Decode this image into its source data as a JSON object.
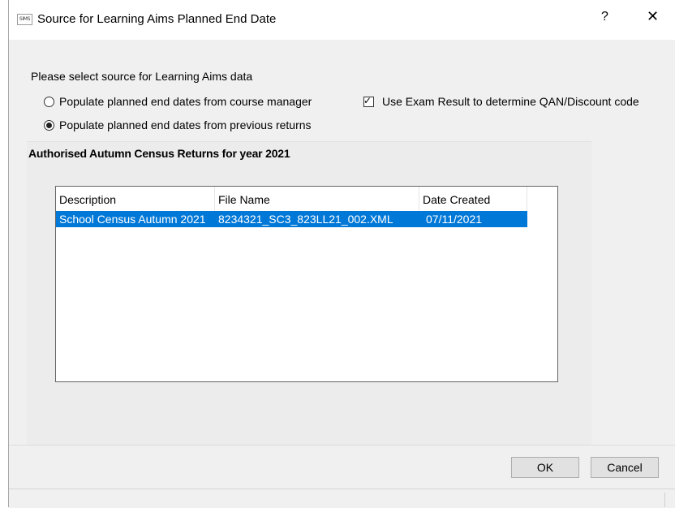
{
  "window": {
    "app_icon_text": "SIMS",
    "title": "Source for Learning Aims Planned End Date",
    "help_glyph": "?",
    "close_glyph": "✕"
  },
  "source": {
    "prompt": "Please select source for Learning Aims data",
    "option_course_manager": {
      "label": "Populate planned end dates from course manager",
      "selected": false
    },
    "option_previous_returns": {
      "label": "Populate planned end dates from previous returns",
      "selected": true
    },
    "exam_result_checkbox": {
      "label": "Use Exam Result to determine QAN/Discount code",
      "checked": true
    }
  },
  "returns": {
    "title": "Authorised Autumn Census Returns for year 2021",
    "columns": [
      "Description",
      "File Name",
      "Date Created"
    ],
    "rows": [
      {
        "description": "School Census Autumn 2021",
        "file_name": "8234321_SC3_823LL21_002.XML",
        "date_created": "07/11/2021",
        "selected": true
      }
    ]
  },
  "buttons": {
    "ok": "OK",
    "cancel": "Cancel"
  },
  "colors": {
    "selection": "#0078d7",
    "dialog_bg": "#f0f0f0"
  }
}
